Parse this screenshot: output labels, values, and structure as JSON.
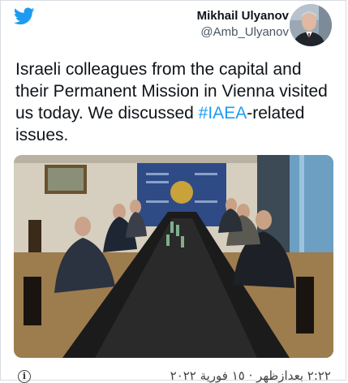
{
  "author": {
    "name": "Mikhail Ulyanov",
    "handle": "@Amb_Ulyanov"
  },
  "tweet": {
    "text_before": "Israeli colleagues from the capital and their Permanent Mission in Vienna visited us today. We discussed ",
    "hashtag": "#IAEA",
    "text_after": "-related issues."
  },
  "footer": {
    "timestamp": "٢:٢٢ بعدازظهر · ١٥ فورية ٢٠٢٢"
  },
  "colors": {
    "twitter_blue": "#1d9bf0",
    "hashtag": "#1d9bf0",
    "text": "#0f1419"
  },
  "icons": {
    "logo": "twitter-bird-icon",
    "info": "info-icon"
  }
}
